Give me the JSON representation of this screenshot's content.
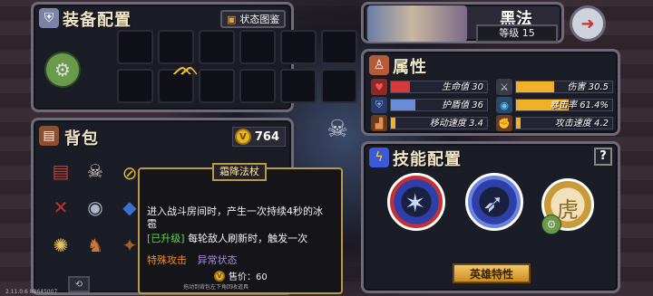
{
  "equipment": {
    "title": "装备配置",
    "status_book_label": "状态图鉴"
  },
  "hero": {
    "name": "黑法",
    "level": "等级 15"
  },
  "attributes": {
    "title": "属性",
    "rows": [
      {
        "label": "生命值 30",
        "fill": 0.2,
        "color": "#d83a3a"
      },
      {
        "label": "伤害 30.5",
        "fill": 0.4,
        "color": "#f2b028"
      },
      {
        "label": "护盾值 36",
        "fill": 0.25,
        "color": "#6a8bd8"
      },
      {
        "label": "暴击率 61.4%",
        "fill": 0.55,
        "color": "#f2b028"
      },
      {
        "label": "移动速度 3.4",
        "fill": 0.05,
        "color": "#f2b028"
      },
      {
        "label": "攻击速度 4.2",
        "fill": 0.05,
        "color": "#f2b028"
      }
    ]
  },
  "backpack": {
    "title": "背包",
    "coins": "764"
  },
  "tooltip": {
    "title": "霜降法杖",
    "line1": "进入战斗房间时，产生一次持续4秒的冰",
    "line2": "雹",
    "line3_tag": "[已升级]",
    "line3_text": " 每轮敌人刷新时，触发一次",
    "tag_special": "特殊攻击",
    "tag_status": "异常状态",
    "price": "售价：60",
    "hint": "拖动到背包左下角回收道具"
  },
  "skills": {
    "title": "技能配置",
    "help": "?",
    "hero_trait_label": "英雄特性"
  },
  "version": "2.11.0.6 88645007",
  "colors": {
    "panel_border": "#6e6a78",
    "gold": "#e5b523",
    "accent_blue": "#3b6ad8"
  }
}
